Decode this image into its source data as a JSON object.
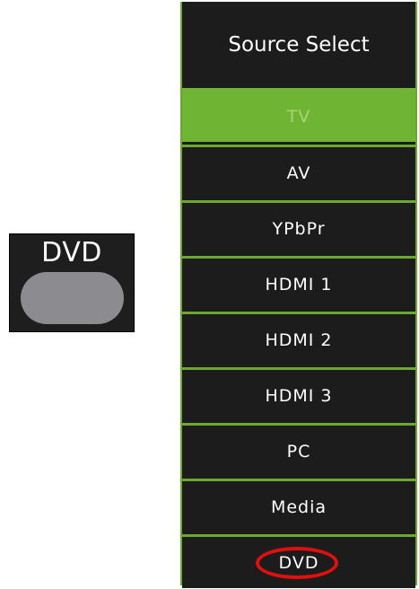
{
  "remote": {
    "button_label": "DVD"
  },
  "source_select": {
    "title": "Source Select",
    "items": [
      {
        "label": "TV",
        "selected": true
      },
      {
        "label": "AV",
        "selected": false
      },
      {
        "label": "YPbPr",
        "selected": false
      },
      {
        "label": "HDMI 1",
        "selected": false
      },
      {
        "label": "HDMI 2",
        "selected": false
      },
      {
        "label": "HDMI 3",
        "selected": false
      },
      {
        "label": "PC",
        "selected": false
      },
      {
        "label": "Media",
        "selected": false
      },
      {
        "label": "DVD",
        "selected": false,
        "highlighted": true
      }
    ]
  },
  "colors": {
    "menu_background": "#1c1c1c",
    "accent_green": "#70b434",
    "selected_text": "#a8d37a",
    "highlight_red": "#e01010",
    "button_cap": "#8c8c90"
  }
}
